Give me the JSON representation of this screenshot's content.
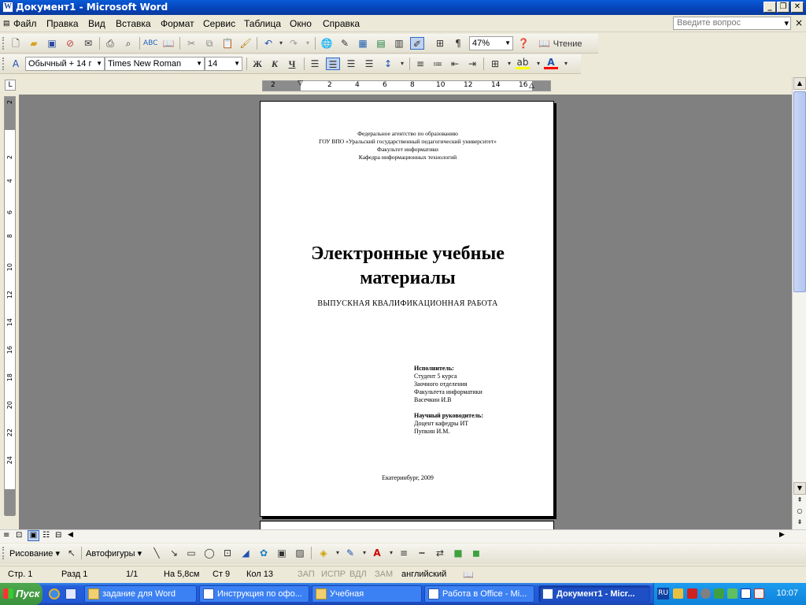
{
  "window": {
    "title": "Документ1 - Microsoft Word",
    "app_icon": "W"
  },
  "menu": {
    "items": [
      "Файл",
      "Правка",
      "Вид",
      "Вставка",
      "Формат",
      "Сервис",
      "Таблица",
      "Окно",
      "Справка"
    ],
    "help_placeholder": "Введите вопрос",
    "close_doc": "×"
  },
  "standard_toolbar": {
    "zoom": "47%",
    "reading_label": "Чтение"
  },
  "formatting_toolbar": {
    "style": "Обычный + 14 г",
    "font": "Times New Roman",
    "size": "14",
    "bold": "Ж",
    "italic": "К",
    "underline": "Ч",
    "highlight_color": "#ffff00",
    "font_color": "#ff0000"
  },
  "ruler": {
    "h_labels": [
      "2",
      "2",
      "4",
      "6",
      "8",
      "10",
      "12",
      "14",
      "16"
    ],
    "v_labels": [
      "2",
      "2",
      "4",
      "6",
      "8",
      "10",
      "12",
      "14",
      "16",
      "18",
      "20",
      "22",
      "24"
    ]
  },
  "document": {
    "header_lines": [
      "Федеральное агентство по образованию",
      "ГОУ ВПО «Уральский государственный педагогический университет»",
      "Факультет информатики",
      "Кафедра информационных технологий"
    ],
    "title_line1": "Электронные учебные",
    "title_line2": "материалы",
    "subtitle": "ВЫПУСКНАЯ КВАЛИФИКАЦИОННАЯ РАБОТА",
    "executor_label": "Исполнитель:",
    "executor_lines": [
      "Студент 5 курса",
      "Заочного отделения",
      "Факультета информатики",
      "Васечкин И.В"
    ],
    "supervisor_label": "Научный руководитель:",
    "supervisor_lines": [
      "Доцент кафедры ИТ",
      "Пупкин И.М."
    ],
    "city_year": "Екатеринбург, 2009"
  },
  "drawing_toolbar": {
    "drawing_label": "Рисование",
    "autoshapes_label": "Автофигуры"
  },
  "status": {
    "page": "Стр. 1",
    "section": "Разд 1",
    "pages": "1/1",
    "at": "На 5,8см",
    "line": "Ст 9",
    "col": "Кол 13",
    "rec": "ЗАП",
    "trk": "ИСПР",
    "ext": "ВДЛ",
    "ovr": "ЗАМ",
    "language": "английский"
  },
  "taskbar": {
    "start": "Пуск",
    "tasks": [
      "задание для Word",
      "Инструкция по офо...",
      "Учебная",
      "Работа в Office - Mi...",
      "Документ1 - Micr..."
    ],
    "lang": "RU",
    "clock": "10:07"
  }
}
